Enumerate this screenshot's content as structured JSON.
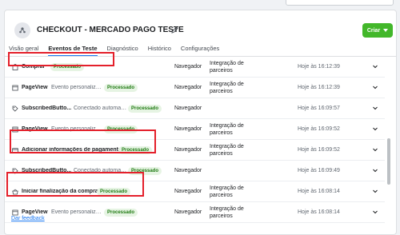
{
  "header": {
    "title": "CHECKOUT - MERCADO PAGO TESTE",
    "create_button": "Criar"
  },
  "tabs": [
    {
      "label": "Visão geral",
      "active": false
    },
    {
      "label": "Eventos de Teste",
      "active": true
    },
    {
      "label": "Diagnóstico",
      "active": false
    },
    {
      "label": "Histórico",
      "active": false
    },
    {
      "label": "Configurações",
      "active": false
    }
  ],
  "events": [
    {
      "icon": "bag-icon",
      "name": "Comprar",
      "description": "",
      "status": "Processado",
      "source": "Navegador",
      "integration": "Integração de parceiros",
      "time": "Hoje às 16:12:39",
      "highlighted": true
    },
    {
      "icon": "page-icon",
      "name": "PageView",
      "description": "Evento personalizado",
      "status": "Processado",
      "source": "Navegador",
      "integration": "Integração de parceiros",
      "time": "Hoje às 16:12:39",
      "highlighted": false
    },
    {
      "icon": "tag-icon",
      "name": "SubscribedButto...",
      "description": "Conectado automatic...",
      "status": "Processado",
      "source": "Navegador",
      "integration": "",
      "time": "Hoje às 16:09:57",
      "highlighted": false
    },
    {
      "icon": "page-icon",
      "name": "PageView",
      "description": "Evento personalizado",
      "status": "Processado",
      "source": "Navegador",
      "integration": "Integração de parceiros",
      "time": "Hoje às 16:09:52",
      "highlighted": false
    },
    {
      "icon": "card-icon",
      "name": "Adicionar informações de pagamento",
      "description": "",
      "status": "Processado",
      "source": "Navegador",
      "integration": "Integração de parceiros",
      "time": "Hoje às 16:09:52",
      "highlighted": true
    },
    {
      "icon": "tag-icon",
      "name": "SubscribedButto...",
      "description": "Conectado automatic...",
      "status": "Processado",
      "source": "Navegador",
      "integration": "",
      "time": "Hoje às 16:09:49",
      "highlighted": false
    },
    {
      "icon": "basket-icon",
      "name": "Iniciar finalização da compra",
      "description": "",
      "status": "Processado",
      "source": "Navegador",
      "integration": "Integração de parceiros",
      "time": "Hoje às 16:08:14",
      "highlighted": true
    },
    {
      "icon": "page-icon",
      "name": "PageView",
      "description": "Evento personalizado",
      "status": "Processado",
      "source": "Navegador",
      "integration": "Integração de parceiros",
      "time": "Hoje às 16:08:14",
      "highlighted": false
    }
  ],
  "footer": {
    "feedback_link": "Dar feedback"
  },
  "colors": {
    "accent": "#1877f2",
    "create_button": "#42b72a",
    "badge_bg": "#e6f4e3",
    "badge_text": "#1f7a12",
    "highlight": "#e4202b"
  }
}
